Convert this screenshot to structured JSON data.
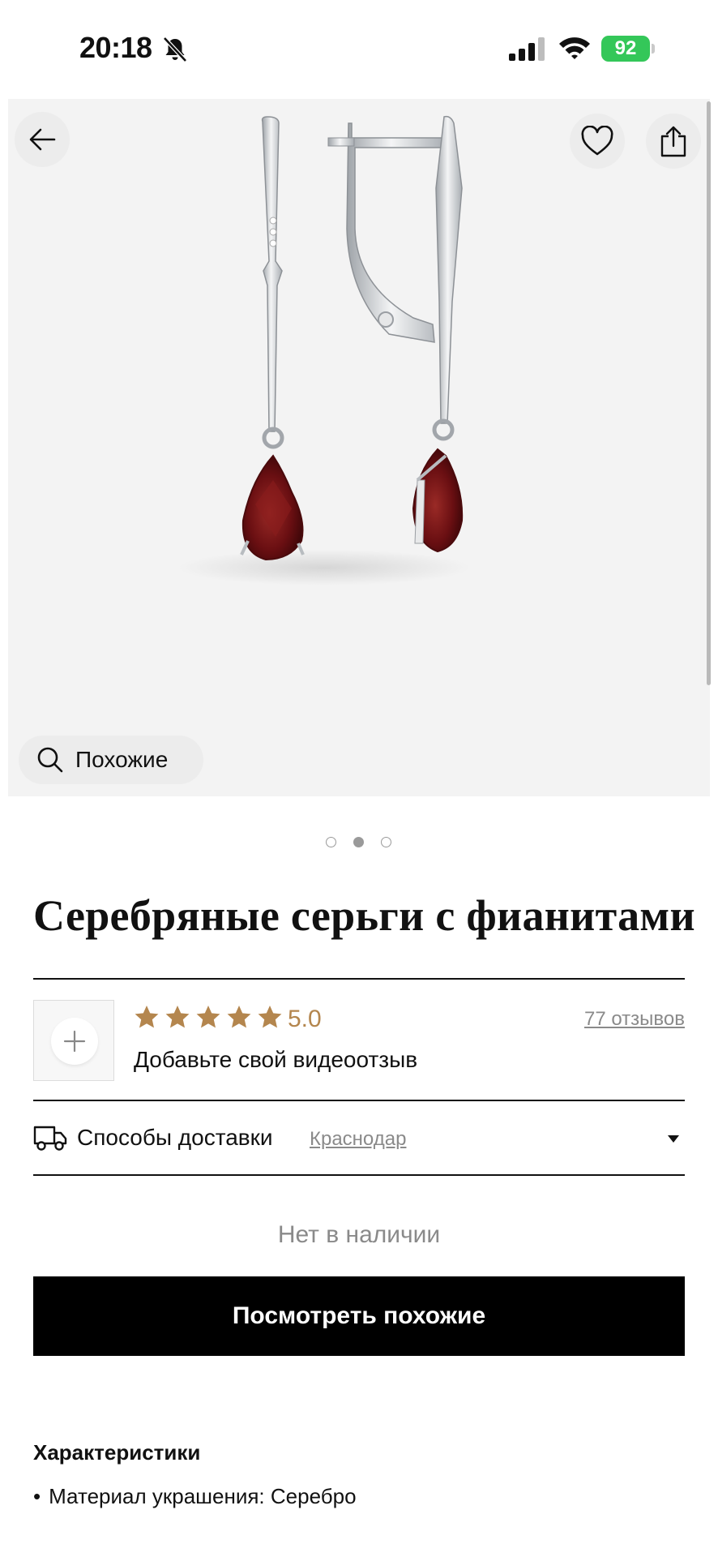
{
  "status_bar": {
    "time": "20:18",
    "battery": "92"
  },
  "gallery": {
    "similar_label": "Похожие",
    "page_count": 3,
    "active_page": 2
  },
  "product": {
    "title": "Серебряные серьги с фианитами"
  },
  "reviews": {
    "rating": "5.0",
    "stars": 5,
    "count_label": "77 отзывов",
    "add_video_label": "Добавьте свой видеоотзыв"
  },
  "delivery": {
    "label": "Способы доставки",
    "city": "Краснодар"
  },
  "availability": "Нет в наличии",
  "cta_label": "Посмотреть похожие",
  "specs": {
    "title": "Характеристики",
    "items": [
      "Материал украшения: Серебро"
    ]
  },
  "colors": {
    "accent_star": "#b4864e",
    "cta_bg": "#000000",
    "battery": "#34c759"
  },
  "icons": [
    "bell-slash-icon",
    "signal-icon",
    "wifi-icon",
    "back-arrow-icon",
    "heart-icon",
    "share-icon",
    "search-icon",
    "plus-icon",
    "star-icon",
    "truck-icon",
    "chevron-down-icon"
  ]
}
